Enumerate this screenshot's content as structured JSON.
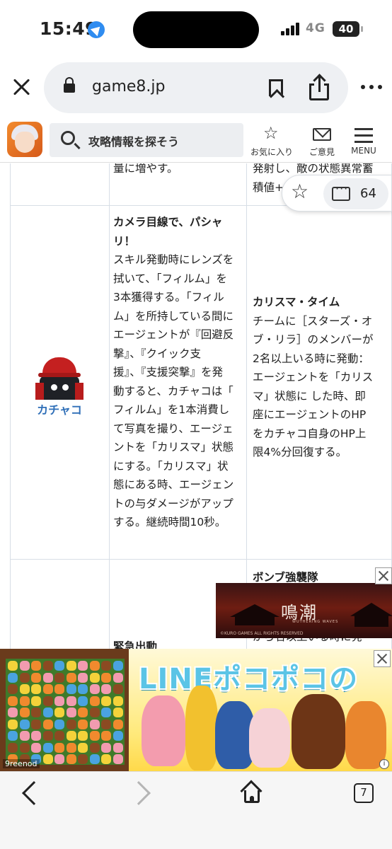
{
  "status_bar": {
    "time": "15:49",
    "network": "4G",
    "battery": "40"
  },
  "browser": {
    "url": "game8.jp",
    "tab_count": "7"
  },
  "site_header": {
    "search_placeholder": "攻略情報を探そう",
    "favorites_label": "お気に入り",
    "feedback_label": "ご意見",
    "menu_label": "MENU"
  },
  "floating_actions": {
    "comment_count": "64"
  },
  "table": {
    "top_row": {
      "col1_text": "量に増やす。",
      "col2_lines": [
        "発射し、敵の状態異常蓄",
        "積値+"
      ]
    },
    "kachaco_row": {
      "character_name": "カチャコ",
      "skill_title_lines": [
        "カメラ目線で、パシャ",
        "リ！"
      ],
      "skill_desc_lines": [
        "スキル発動時にレンズを",
        "拭いて、「フィルム」を",
        "3本獲得する。「フィル",
        "ム」を所持している間に",
        "エージェントが『回避反",
        "撃』、『クイック支",
        "援』、『支援突撃』を発",
        "動すると、カチャコは「",
        "フィルム」を1本消費し",
        "て写真を撮り、エージェ",
        "ントを「カリスマ」状態",
        "にする。「カリスマ」状",
        "態にある時、エージェン",
        "トの与ダメージがアップ",
        "する。継続時間10秒。"
      ],
      "passive_title": "カリスマ・タイム",
      "passive_desc_lines": [
        "チームに［スターズ・オ",
        "ブ・リラ］のメンバーが",
        "2名以上いる時に発動：",
        "エージェントを「カリス",
        "マ」状態に した時、即",
        "座にエージェントのHP",
        "をカチャコ自身のHP上",
        "限4%分回復する。"
      ]
    },
    "next_row": {
      "col1_title": "緊急出動",
      "col2_title": "ボンブ強襲隊",
      "col2_partial": "がら名以上いる時に発"
    }
  },
  "ads": {
    "small_ad": {
      "title": "鳴潮",
      "subtitle": "WUTHERING WAVES",
      "copyright": "©KURO GAMES ALL RIGHTS RESERVED"
    },
    "banner_ad": {
      "title": "LINEポコポコの",
      "brand": "9reenod",
      "info": "i"
    }
  }
}
